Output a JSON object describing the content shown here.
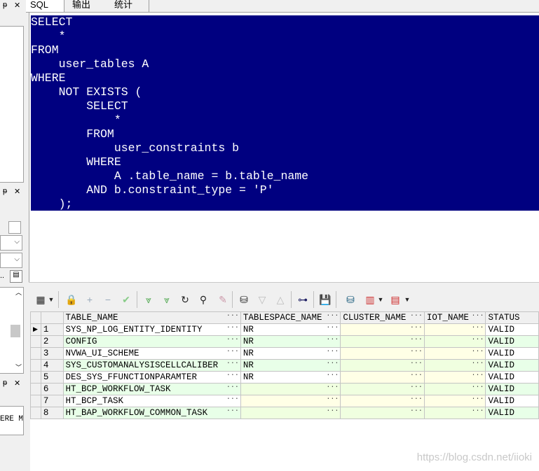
{
  "tabs": [
    {
      "label": "SQL",
      "active": true
    },
    {
      "label": "输出",
      "active": false
    },
    {
      "label": "统计",
      "active": false
    }
  ],
  "left_panel": {
    "pin_glyph": "ᵽ",
    "close_glyph": "✕",
    "truncated_labels": [
      "..",
      "ERE M"
    ]
  },
  "sql_lines": [
    "SELECT",
    "    *",
    "FROM",
    "    user_tables A",
    "WHERE",
    "    NOT EXISTS (",
    "        SELECT",
    "            *",
    "        FROM",
    "            user_constraints b",
    "        WHERE",
    "            A .table_name = b.table_name",
    "        AND b.constraint_type = 'P'",
    "    );"
  ],
  "grid": {
    "columns": [
      "TABLE_NAME",
      "TABLESPACE_NAME",
      "CLUSTER_NAME",
      "IOT_NAME",
      "STATUS"
    ],
    "rows": [
      {
        "n": "1",
        "cells": [
          "SYS_NP_LOG_ENTITY_IDENTITY",
          "NR",
          "",
          "",
          "VALID"
        ]
      },
      {
        "n": "2",
        "cells": [
          "CONFIG",
          "NR",
          "",
          "",
          "VALID"
        ]
      },
      {
        "n": "3",
        "cells": [
          "NVWA_UI_SCHEME",
          "NR",
          "",
          "",
          "VALID"
        ]
      },
      {
        "n": "4",
        "cells": [
          "SYS_CUSTOMANALYSISCELLCALIBER",
          "NR",
          "",
          "",
          "VALID"
        ]
      },
      {
        "n": "5",
        "cells": [
          "DES_SYS_FFUNCTIONPARAMTER",
          "NR",
          "",
          "",
          "VALID"
        ]
      },
      {
        "n": "6",
        "cells": [
          "HT_BCP_WORKFLOW_TASK",
          "",
          "",
          "",
          "VALID"
        ]
      },
      {
        "n": "7",
        "cells": [
          "HT_BCP_TASK",
          "",
          "",
          "",
          "VALID"
        ]
      },
      {
        "n": "8",
        "cells": [
          "HT_BAP_WORKFLOW_COMMON_TASK",
          "",
          "",
          "",
          "VALID"
        ]
      }
    ],
    "cell_button": "···",
    "current_row_marker": "▶"
  },
  "toolbar_icons": [
    "grid-menu-icon",
    "lock-icon",
    "add-row-icon",
    "delete-row-icon",
    "post-icon",
    "fetch-next-icon",
    "fetch-all-icon",
    "refresh-icon",
    "find-icon",
    "clear-icon",
    "query-by-example-icon",
    "filter-icon",
    "sort-icon",
    "link-icon",
    "save-icon",
    "export-icon",
    "chart-icon",
    "html-export-icon"
  ],
  "watermark": "https://blog.csdn.net/iioki",
  "colors": {
    "selection": "#000080",
    "alt_row": "#e8ffe8",
    "null_cell": "#ffffe6"
  }
}
